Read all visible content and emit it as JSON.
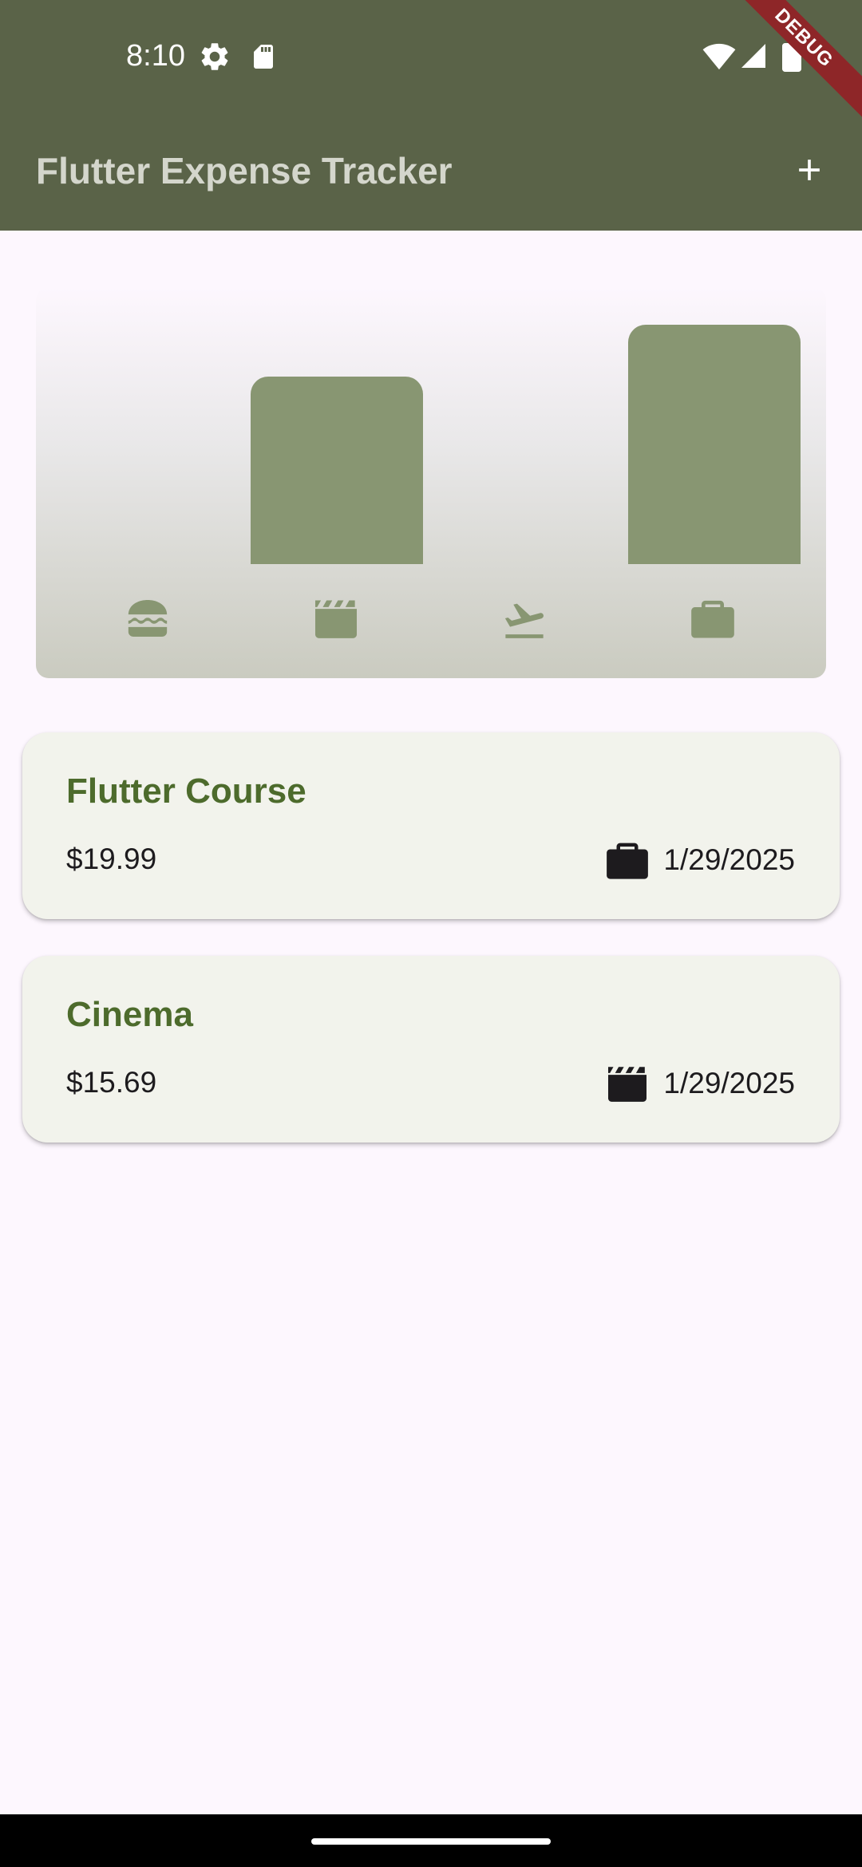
{
  "status_bar": {
    "time": "8:10",
    "left_icons": [
      "settings-icon",
      "sd-card-icon"
    ],
    "right_icons": [
      "wifi-icon",
      "signal-icon",
      "battery-icon"
    ]
  },
  "debug_banner": "DEBUG",
  "app_bar": {
    "title": "Flutter Expense Tracker",
    "action_icon": "add-icon",
    "background_color": "#5A6348"
  },
  "chart_data": {
    "type": "bar",
    "categories": [
      "food",
      "leisure",
      "travel",
      "work"
    ],
    "category_icons": [
      "burger-icon",
      "clapperboard-icon",
      "flight-takeoff-icon",
      "work-icon"
    ],
    "values": [
      0,
      15.69,
      0,
      19.99
    ],
    "bar_color": "#889672"
  },
  "expenses": [
    {
      "title": "Flutter Course",
      "amount": "$19.99",
      "category_icon": "work-icon",
      "date": "1/29/2025"
    },
    {
      "title": "Cinema",
      "amount": "$15.69",
      "category_icon": "clapperboard-icon",
      "date": "1/29/2025"
    }
  ]
}
